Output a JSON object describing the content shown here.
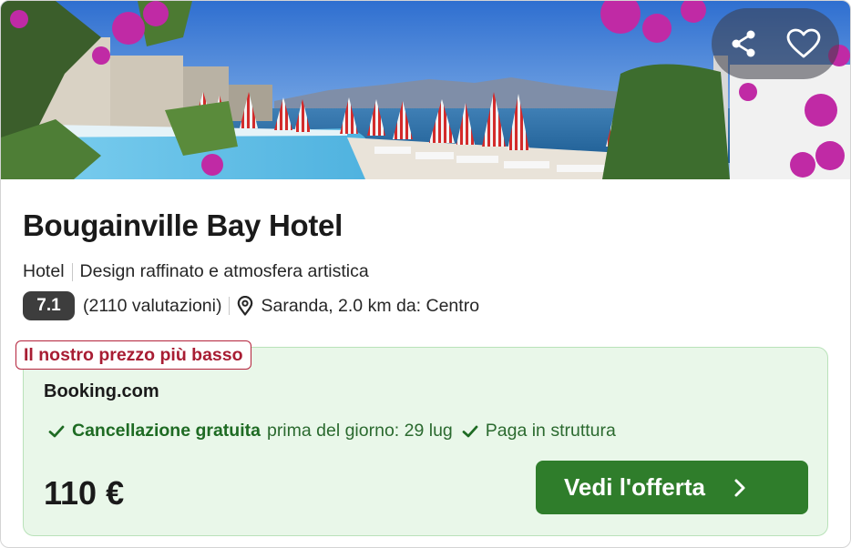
{
  "hotel": {
    "name": "Bougainville Bay Hotel",
    "type": "Hotel",
    "tagline": "Design raffinato e atmosfera artistica",
    "rating": "7.1",
    "reviews": "(2110 valutazioni)",
    "location": "Saranda, 2.0 km da: Centro"
  },
  "deal": {
    "badge": "Il nostro prezzo più basso",
    "provider": "Booking.com",
    "free_cancel": "Cancellazione gratuita",
    "free_cancel_detail": "prima del giorno: 29 lug",
    "pay_at_property": "Paga in struttura",
    "price": "110 €",
    "cta_label": "Vedi l'offerta"
  },
  "colors": {
    "rating_badge": "#3d3d3d",
    "deal_background": "#e9f7e9",
    "badge_red": "#a81d33",
    "cta_green": "#2f7d2b"
  },
  "icons": [
    "share-icon",
    "heart-icon",
    "map-pin-icon",
    "check-icon",
    "chevron-right-icon"
  ]
}
